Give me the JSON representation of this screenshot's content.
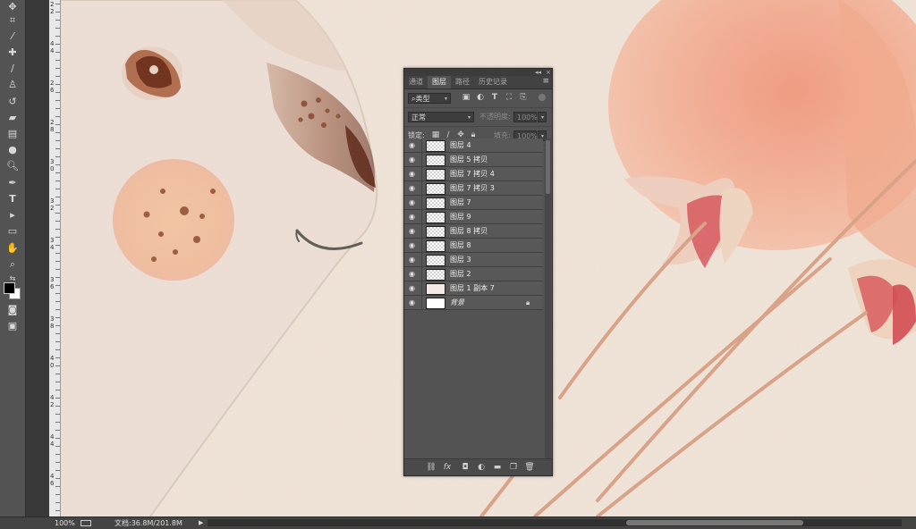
{
  "panel": {
    "tabs": [
      "通道",
      "图层",
      "路径",
      "历史记录"
    ],
    "active_tab": 1,
    "filter_kind": "类型",
    "blend_mode": "正常",
    "opacity_label": "不透明度:",
    "opacity_value": "100%",
    "lock_label": "锁定:",
    "fill_label": "填充:",
    "fill_value": "100%",
    "menu_glyph": "≡",
    "collapse_glyph": "◂◂",
    "close_glyph": "×"
  },
  "layers": [
    {
      "name": "图层 4",
      "thumb": "transparent"
    },
    {
      "name": "图层 5 拷贝",
      "thumb": "transparent"
    },
    {
      "name": "图层 7 拷贝 4",
      "thumb": "transparent"
    },
    {
      "name": "图层 7 拷贝 3",
      "thumb": "transparent"
    },
    {
      "name": "图层 7",
      "thumb": "transparent"
    },
    {
      "name": "图层 9",
      "thumb": "transparent"
    },
    {
      "name": "图层 8 拷贝",
      "thumb": "transparent"
    },
    {
      "name": "图层 8",
      "thumb": "transparent"
    },
    {
      "name": "图层 3",
      "thumb": "transparent"
    },
    {
      "name": "图层 2",
      "thumb": "transparent"
    },
    {
      "name": "图层 1 副本 7",
      "thumb": "solid"
    },
    {
      "name": "背景",
      "thumb": "white",
      "locked": true
    }
  ],
  "status": {
    "zoom": "100%",
    "doc_info": "文档:36.8M/201.8M",
    "arrow": "▶"
  },
  "ruler_labels": [
    "2",
    "2",
    "4",
    "4",
    "2",
    "6",
    "2",
    "8",
    "3",
    "0",
    "3",
    "2",
    "3",
    "4",
    "3",
    "6",
    "3",
    "8",
    "4",
    "0",
    "4",
    "2",
    "4",
    "4",
    "4",
    "6"
  ],
  "tools": [
    "move-icon",
    "crop-icon",
    "eyedropper-icon",
    "healing-brush-icon",
    "brush-icon",
    "clone-stamp-icon",
    "history-brush-icon",
    "eraser-icon",
    "gradient-icon",
    "blur-icon",
    "dodge-icon",
    "pen-icon",
    "type-icon",
    "path-selection-icon",
    "rectangle-shape-icon",
    "hand-icon",
    "zoom-icon",
    "swap-colors-icon",
    "foreground-background-icon",
    "quick-mask-icon",
    "screen-mode-icon"
  ],
  "colors": {
    "canvas": "#f1e4d9",
    "balloon": "#f3b49a",
    "panel": "#535353"
  }
}
